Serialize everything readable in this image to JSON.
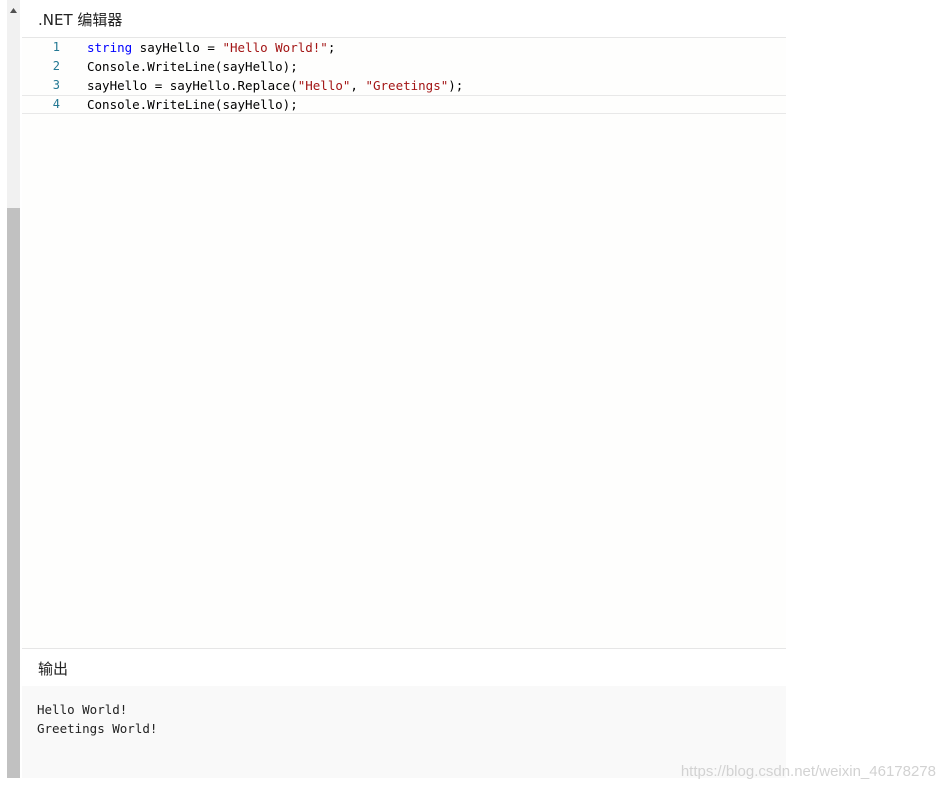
{
  "editor": {
    "title": ".NET 编辑器",
    "lines": [
      {
        "number": "1",
        "tokens": [
          {
            "text": "string",
            "kind": "keyword"
          },
          {
            "text": " sayHello = ",
            "kind": "plain"
          },
          {
            "text": "\"Hello World!\"",
            "kind": "string"
          },
          {
            "text": ";",
            "kind": "plain"
          }
        ]
      },
      {
        "number": "2",
        "tokens": [
          {
            "text": "Console.WriteLine(sayHello);",
            "kind": "plain"
          }
        ]
      },
      {
        "number": "3",
        "tokens": [
          {
            "text": "sayHello = sayHello.Replace(",
            "kind": "plain"
          },
          {
            "text": "\"Hello\"",
            "kind": "string"
          },
          {
            "text": ", ",
            "kind": "plain"
          },
          {
            "text": "\"Greetings\"",
            "kind": "string"
          },
          {
            "text": ");",
            "kind": "plain"
          }
        ]
      },
      {
        "number": "4",
        "tokens": [
          {
            "text": "Console.WriteLine(sayHello);",
            "kind": "plain"
          }
        ]
      }
    ],
    "current_line": 4
  },
  "output": {
    "title": "输出",
    "lines": [
      "Hello World!",
      "Greetings World!"
    ]
  },
  "watermark": "https://blog.csdn.net/weixin_46178278",
  "colors": {
    "keyword": "#0000ff",
    "string": "#a31515",
    "line_number": "#237893"
  },
  "icons": {
    "scroll_up": "triangle-up-icon"
  }
}
